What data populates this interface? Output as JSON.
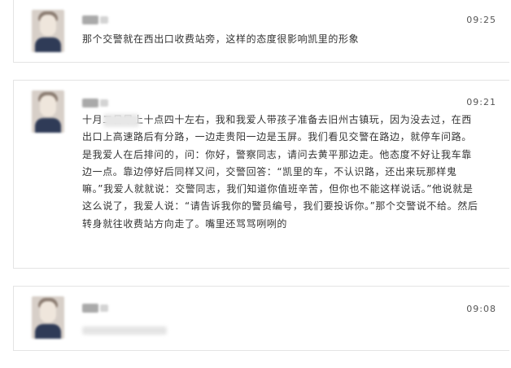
{
  "comments": [
    {
      "time": "09:25",
      "text": "那个交警就在西出口收费站旁，这样的态度很影响凯里的形象"
    },
    {
      "time": "09:21",
      "text": "十月二日早上十点四十左右，我和我爱人带孩子准备去旧州古镇玩，因为没去过，在西出口上高速路后有分路，一边走贵阳一边是玉屏。我们看见交警在路边，就停车问路。是我爱人在后排问的，问：你好，警察同志，请问去黄平那边走。他态度不好让我车靠边一点。靠边停好后同样又问，交警回答：“凯里的车，不认识路，还出来玩那样鬼嘛。”我爱人就就说：交警同志，我们知道你值班辛苦，但你也不能这样说话。”他说就是这么说了，我爱人说：“请告诉我你的警员编号，我们要投诉你。”那个交警说不给。然后转身就往收费站方向走了。嘴里还骂骂咧咧的"
    },
    {
      "time": "09:08",
      "text": ""
    }
  ]
}
